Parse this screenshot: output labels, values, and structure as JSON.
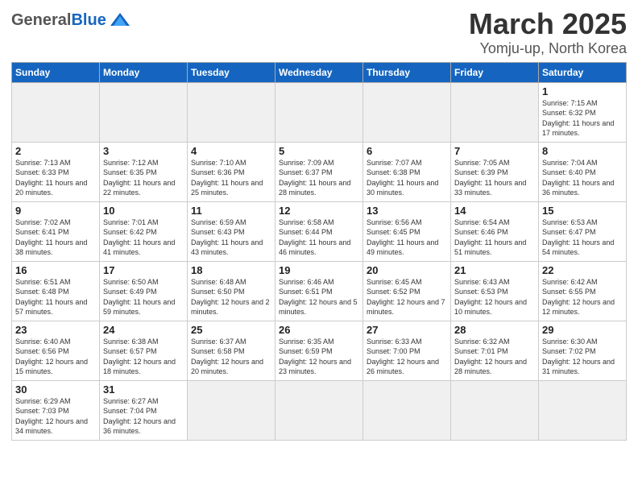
{
  "header": {
    "logo_general": "General",
    "logo_blue": "Blue",
    "title": "March 2025",
    "subtitle": "Yomju-up, North Korea"
  },
  "weekdays": [
    "Sunday",
    "Monday",
    "Tuesday",
    "Wednesday",
    "Thursday",
    "Friday",
    "Saturday"
  ],
  "weeks": [
    [
      {
        "day": "",
        "info": ""
      },
      {
        "day": "",
        "info": ""
      },
      {
        "day": "",
        "info": ""
      },
      {
        "day": "",
        "info": ""
      },
      {
        "day": "",
        "info": ""
      },
      {
        "day": "",
        "info": ""
      },
      {
        "day": "1",
        "info": "Sunrise: 7:15 AM\nSunset: 6:32 PM\nDaylight: 11 hours\nand 17 minutes."
      }
    ],
    [
      {
        "day": "2",
        "info": "Sunrise: 7:13 AM\nSunset: 6:33 PM\nDaylight: 11 hours\nand 20 minutes."
      },
      {
        "day": "3",
        "info": "Sunrise: 7:12 AM\nSunset: 6:35 PM\nDaylight: 11 hours\nand 22 minutes."
      },
      {
        "day": "4",
        "info": "Sunrise: 7:10 AM\nSunset: 6:36 PM\nDaylight: 11 hours\nand 25 minutes."
      },
      {
        "day": "5",
        "info": "Sunrise: 7:09 AM\nSunset: 6:37 PM\nDaylight: 11 hours\nand 28 minutes."
      },
      {
        "day": "6",
        "info": "Sunrise: 7:07 AM\nSunset: 6:38 PM\nDaylight: 11 hours\nand 30 minutes."
      },
      {
        "day": "7",
        "info": "Sunrise: 7:05 AM\nSunset: 6:39 PM\nDaylight: 11 hours\nand 33 minutes."
      },
      {
        "day": "8",
        "info": "Sunrise: 7:04 AM\nSunset: 6:40 PM\nDaylight: 11 hours\nand 36 minutes."
      }
    ],
    [
      {
        "day": "9",
        "info": "Sunrise: 7:02 AM\nSunset: 6:41 PM\nDaylight: 11 hours\nand 38 minutes."
      },
      {
        "day": "10",
        "info": "Sunrise: 7:01 AM\nSunset: 6:42 PM\nDaylight: 11 hours\nand 41 minutes."
      },
      {
        "day": "11",
        "info": "Sunrise: 6:59 AM\nSunset: 6:43 PM\nDaylight: 11 hours\nand 43 minutes."
      },
      {
        "day": "12",
        "info": "Sunrise: 6:58 AM\nSunset: 6:44 PM\nDaylight: 11 hours\nand 46 minutes."
      },
      {
        "day": "13",
        "info": "Sunrise: 6:56 AM\nSunset: 6:45 PM\nDaylight: 11 hours\nand 49 minutes."
      },
      {
        "day": "14",
        "info": "Sunrise: 6:54 AM\nSunset: 6:46 PM\nDaylight: 11 hours\nand 51 minutes."
      },
      {
        "day": "15",
        "info": "Sunrise: 6:53 AM\nSunset: 6:47 PM\nDaylight: 11 hours\nand 54 minutes."
      }
    ],
    [
      {
        "day": "16",
        "info": "Sunrise: 6:51 AM\nSunset: 6:48 PM\nDaylight: 11 hours\nand 57 minutes."
      },
      {
        "day": "17",
        "info": "Sunrise: 6:50 AM\nSunset: 6:49 PM\nDaylight: 11 hours\nand 59 minutes."
      },
      {
        "day": "18",
        "info": "Sunrise: 6:48 AM\nSunset: 6:50 PM\nDaylight: 12 hours\nand 2 minutes."
      },
      {
        "day": "19",
        "info": "Sunrise: 6:46 AM\nSunset: 6:51 PM\nDaylight: 12 hours\nand 5 minutes."
      },
      {
        "day": "20",
        "info": "Sunrise: 6:45 AM\nSunset: 6:52 PM\nDaylight: 12 hours\nand 7 minutes."
      },
      {
        "day": "21",
        "info": "Sunrise: 6:43 AM\nSunset: 6:53 PM\nDaylight: 12 hours\nand 10 minutes."
      },
      {
        "day": "22",
        "info": "Sunrise: 6:42 AM\nSunset: 6:55 PM\nDaylight: 12 hours\nand 12 minutes."
      }
    ],
    [
      {
        "day": "23",
        "info": "Sunrise: 6:40 AM\nSunset: 6:56 PM\nDaylight: 12 hours\nand 15 minutes."
      },
      {
        "day": "24",
        "info": "Sunrise: 6:38 AM\nSunset: 6:57 PM\nDaylight: 12 hours\nand 18 minutes."
      },
      {
        "day": "25",
        "info": "Sunrise: 6:37 AM\nSunset: 6:58 PM\nDaylight: 12 hours\nand 20 minutes."
      },
      {
        "day": "26",
        "info": "Sunrise: 6:35 AM\nSunset: 6:59 PM\nDaylight: 12 hours\nand 23 minutes."
      },
      {
        "day": "27",
        "info": "Sunrise: 6:33 AM\nSunset: 7:00 PM\nDaylight: 12 hours\nand 26 minutes."
      },
      {
        "day": "28",
        "info": "Sunrise: 6:32 AM\nSunset: 7:01 PM\nDaylight: 12 hours\nand 28 minutes."
      },
      {
        "day": "29",
        "info": "Sunrise: 6:30 AM\nSunset: 7:02 PM\nDaylight: 12 hours\nand 31 minutes."
      }
    ],
    [
      {
        "day": "30",
        "info": "Sunrise: 6:29 AM\nSunset: 7:03 PM\nDaylight: 12 hours\nand 34 minutes."
      },
      {
        "day": "31",
        "info": "Sunrise: 6:27 AM\nSunset: 7:04 PM\nDaylight: 12 hours\nand 36 minutes."
      },
      {
        "day": "",
        "info": ""
      },
      {
        "day": "",
        "info": ""
      },
      {
        "day": "",
        "info": ""
      },
      {
        "day": "",
        "info": ""
      },
      {
        "day": "",
        "info": ""
      }
    ]
  ]
}
